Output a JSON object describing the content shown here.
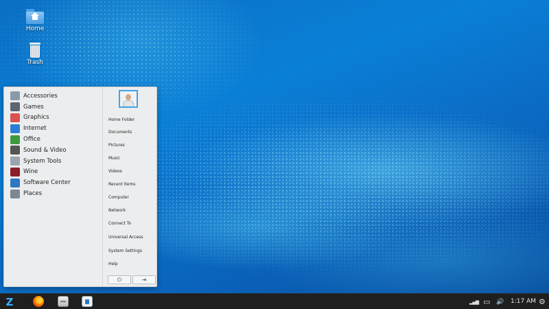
{
  "desktop": {
    "icons": [
      {
        "label": "Home",
        "icon": "home-folder-icon"
      },
      {
        "label": "Trash",
        "icon": "trash-icon"
      }
    ]
  },
  "start_menu": {
    "categories": [
      {
        "label": "Accessories",
        "icon": "accessories-icon",
        "color": "#8a9aa8"
      },
      {
        "label": "Games",
        "icon": "games-icon",
        "color": "#5b6570"
      },
      {
        "label": "Graphics",
        "icon": "graphics-icon",
        "color": "#d9534f"
      },
      {
        "label": "Internet",
        "icon": "internet-icon",
        "color": "#2a7fd4"
      },
      {
        "label": "Office",
        "icon": "office-icon",
        "color": "#3c9a3c"
      },
      {
        "label": "Sound & Video",
        "icon": "sound-video-icon",
        "color": "#555555"
      },
      {
        "label": "System Tools",
        "icon": "system-tools-icon",
        "color": "#9aa5ae"
      },
      {
        "label": "Wine",
        "icon": "wine-icon",
        "color": "#8b1e2b"
      },
      {
        "label": "Software Center",
        "icon": "software-center-icon",
        "color": "#2f78c4"
      },
      {
        "label": "Places",
        "icon": "places-icon",
        "color": "#7c8893"
      }
    ],
    "places": [
      "Home Folder",
      "Documents",
      "Pictures",
      "Music",
      "Videos",
      "Recent Items",
      "Computer",
      "Network",
      "Connect To",
      "Universal Access",
      "System Settings",
      "Help"
    ],
    "power_icon": "power-icon",
    "logout_icon": "logout-icon",
    "power_glyph": "⏻",
    "logout_glyph": "⇥"
  },
  "taskbar": {
    "menu_glyph": "Z",
    "apps": [
      {
        "name": "firefox-icon"
      },
      {
        "name": "files-icon"
      },
      {
        "name": "software-icon"
      }
    ],
    "tray": {
      "signal_glyph": "▂▄▆",
      "battery_glyph": "▭",
      "volume_glyph": "🔊",
      "settings_glyph": "⚙"
    },
    "clock": "1:17 AM"
  }
}
